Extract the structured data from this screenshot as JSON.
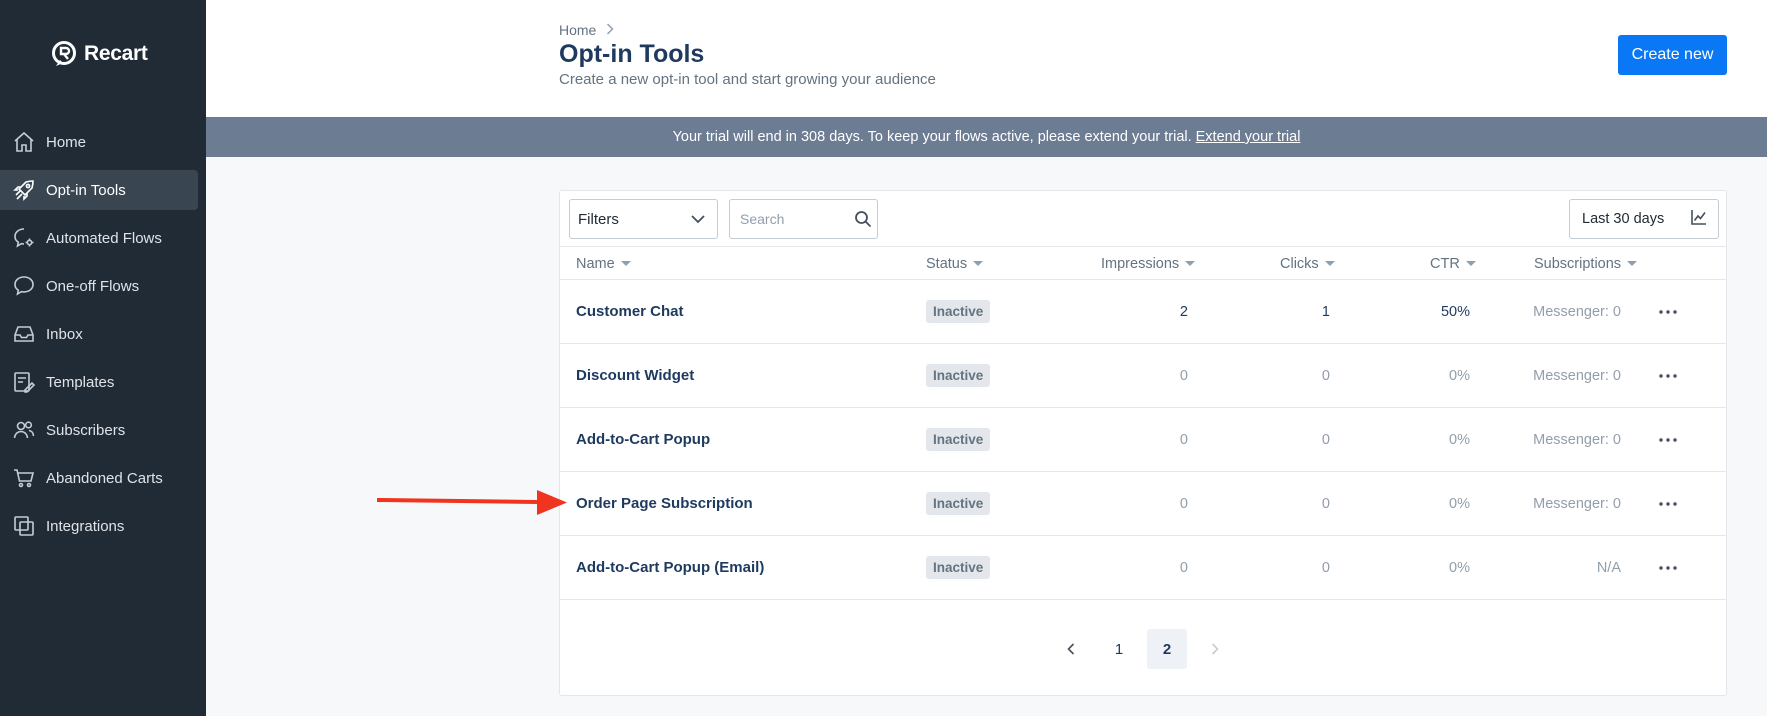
{
  "brand": {
    "name": "Recart"
  },
  "sidebar": {
    "items": [
      {
        "label": "Home",
        "icon": "home-icon",
        "active": false
      },
      {
        "label": "Opt-in Tools",
        "icon": "rocket-icon",
        "active": true
      },
      {
        "label": "Automated Flows",
        "icon": "chat-gear-icon",
        "active": false
      },
      {
        "label": "One-off Flows",
        "icon": "chat-bubble-icon",
        "active": false
      },
      {
        "label": "Inbox",
        "icon": "inbox-icon",
        "active": false
      },
      {
        "label": "Templates",
        "icon": "template-icon",
        "active": false
      },
      {
        "label": "Subscribers",
        "icon": "users-icon",
        "active": false
      },
      {
        "label": "Abandoned Carts",
        "icon": "cart-icon",
        "active": false
      },
      {
        "label": "Integrations",
        "icon": "integrations-icon",
        "active": false
      }
    ]
  },
  "header": {
    "breadcrumb": "Home",
    "title": "Opt-in Tools",
    "subtitle": "Create a new opt-in tool and start growing your audience",
    "create_label": "Create new"
  },
  "banner": {
    "text": "Your trial will end in 308 days. To keep your flows active, please extend your trial.",
    "link": "Extend your trial"
  },
  "toolbar": {
    "filters_label": "Filters",
    "search_placeholder": "Search",
    "date_range": "Last 30 days"
  },
  "table": {
    "columns": [
      "Name",
      "Status",
      "Impressions",
      "Clicks",
      "CTR",
      "Subscriptions"
    ],
    "rows": [
      {
        "name": "Customer Chat",
        "status": "Inactive",
        "impressions": "2",
        "clicks": "1",
        "ctr": "50%",
        "subscriptions": "Messenger: 0"
      },
      {
        "name": "Discount Widget",
        "status": "Inactive",
        "impressions": "0",
        "clicks": "0",
        "ctr": "0%",
        "subscriptions": "Messenger: 0"
      },
      {
        "name": "Add-to-Cart Popup",
        "status": "Inactive",
        "impressions": "0",
        "clicks": "0",
        "ctr": "0%",
        "subscriptions": "Messenger: 0"
      },
      {
        "name": "Order Page Subscription",
        "status": "Inactive",
        "impressions": "0",
        "clicks": "0",
        "ctr": "0%",
        "subscriptions": "Messenger: 0"
      },
      {
        "name": "Add-to-Cart Popup (Email)",
        "status": "Inactive",
        "impressions": "0",
        "clicks": "0",
        "ctr": "0%",
        "subscriptions": "N/A"
      }
    ]
  },
  "pagination": {
    "pages": [
      "1",
      "2"
    ],
    "current": "2"
  },
  "colors": {
    "sidebar": "#212b36",
    "accent": "#0a78f5",
    "banner": "#6b7c93",
    "arrow": "#f0341f"
  }
}
